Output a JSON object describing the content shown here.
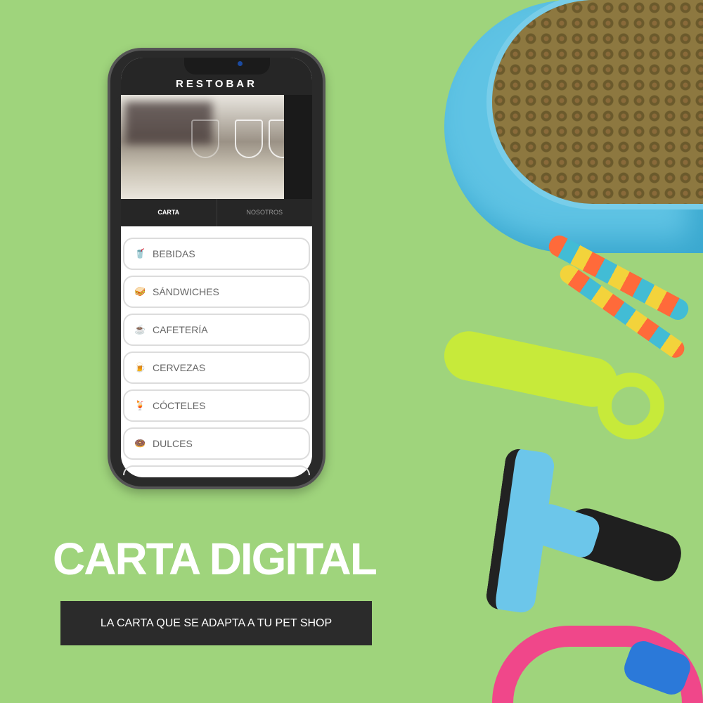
{
  "app": {
    "title": "RESTOBAR",
    "tabs": [
      "CARTA",
      "NOSOTROS"
    ],
    "active_tab": "CARTA"
  },
  "menu": [
    {
      "icon": "🥤",
      "label": "BEBIDAS"
    },
    {
      "icon": "🥪",
      "label": "SÁNDWICHES"
    },
    {
      "icon": "☕",
      "label": "CAFETERÍA"
    },
    {
      "icon": "🍺",
      "label": "CERVEZAS"
    },
    {
      "icon": "🍹",
      "label": "CÓCTELES"
    },
    {
      "icon": "🍩",
      "label": "DULCES"
    }
  ],
  "headline": "CARTA DIGITAL",
  "tagline": "LA CARTA QUE SE ADAPTA A TU PET SHOP",
  "colors": {
    "background": "#9fd47c",
    "dark": "#262626"
  }
}
